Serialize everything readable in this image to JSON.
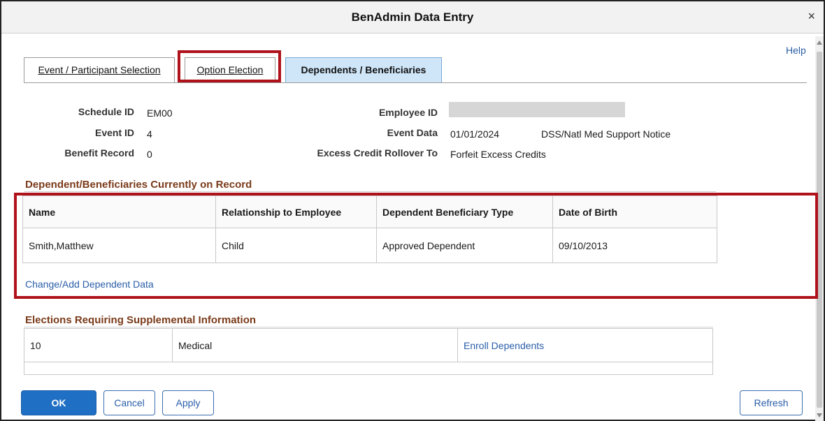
{
  "window": {
    "title": "BenAdmin Data Entry",
    "close_glyph": "×"
  },
  "help_label": "Help",
  "tabs": [
    {
      "label": "Event / Participant Selection",
      "active": false
    },
    {
      "label": "Option Election",
      "active": false
    },
    {
      "label": "Dependents / Beneficiaries",
      "active": true
    }
  ],
  "info": {
    "schedule_id_label": "Schedule ID",
    "schedule_id": "EM00",
    "event_id_label": "Event ID",
    "event_id": "4",
    "benefit_record_label": "Benefit Record",
    "benefit_record": "0",
    "employee_id_label": "Employee ID",
    "employee_id": "",
    "event_data_label": "Event Data",
    "event_data_date": "01/01/2024",
    "event_data_desc": "DSS/Natl Med Support Notice",
    "excess_credit_label": "Excess Credit Rollover To",
    "excess_credit": "Forfeit Excess Credits"
  },
  "dependents": {
    "title": "Dependent/Beneficiaries Currently on Record",
    "columns": [
      "Name",
      "Relationship to Employee",
      "Dependent Beneficiary Type",
      "Date of Birth"
    ],
    "rows": [
      [
        "Smith,Matthew",
        "Child",
        "Approved Dependent",
        "09/10/2013"
      ]
    ],
    "link": "Change/Add Dependent Data"
  },
  "supplemental": {
    "title": "Elections Requiring Supplemental Information",
    "rows": [
      [
        "10",
        "Medical",
        "Enroll Dependents"
      ]
    ]
  },
  "buttons": {
    "ok": "OK",
    "cancel": "Cancel",
    "apply": "Apply",
    "refresh": "Refresh"
  },
  "colors": {
    "highlight": "#b0121b",
    "active_tab": "#cfe6f8",
    "primary": "#1f6fc4",
    "section_title": "#7a3b1a",
    "link": "#2a5ea8"
  },
  "icons": {
    "close": "close-icon",
    "scroll_up": "scroll-up-icon",
    "scroll_down": "scroll-down-icon"
  }
}
